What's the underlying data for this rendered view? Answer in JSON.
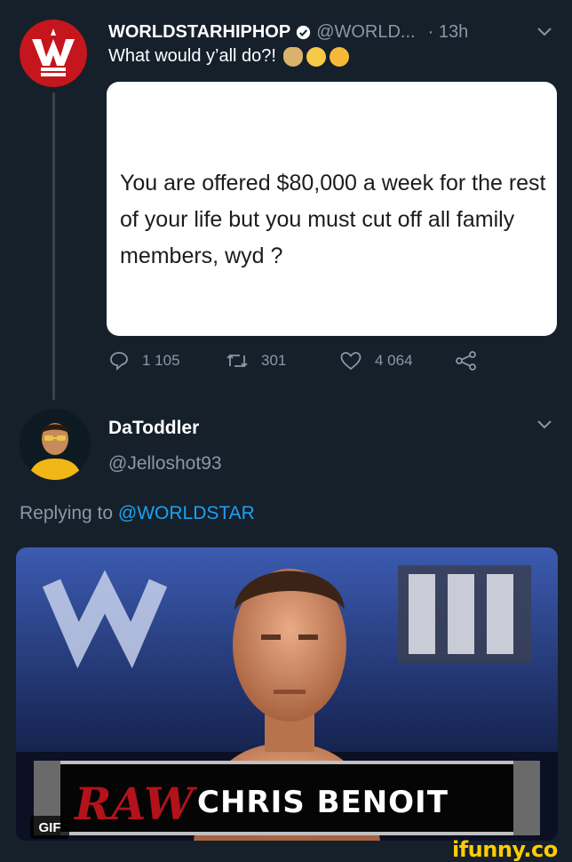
{
  "tweet": {
    "author_name": "WORLDSTARHIPHOP",
    "author_handle": "@WORLD...",
    "time": "· 13h",
    "text": "What would y’all do?!",
    "emojis": [
      "money-bag",
      "flushed-face",
      "thinking-face"
    ],
    "quote_text": "You are offered $80,000 a week for the rest of your life but you must cut off all family members, wyd ?",
    "stats": {
      "replies": "1 105",
      "retweets": "301",
      "likes": "4 064"
    }
  },
  "reply": {
    "author_name": "DaToddler",
    "author_handle": "@Jelloshot93",
    "replying_prefix": "Replying to",
    "replying_mention": "@WORLDSTAR",
    "gif": {
      "badge": "GIF",
      "logo_text": "RAW",
      "caption": "CHRIS BENOIT"
    }
  },
  "watermark": "ifunny.co",
  "colors": {
    "background": "#15202b",
    "secondary_text": "#8899a6",
    "link": "#1da1f2",
    "brand_red": "#c4161c",
    "watermark": "#ffcc00"
  }
}
